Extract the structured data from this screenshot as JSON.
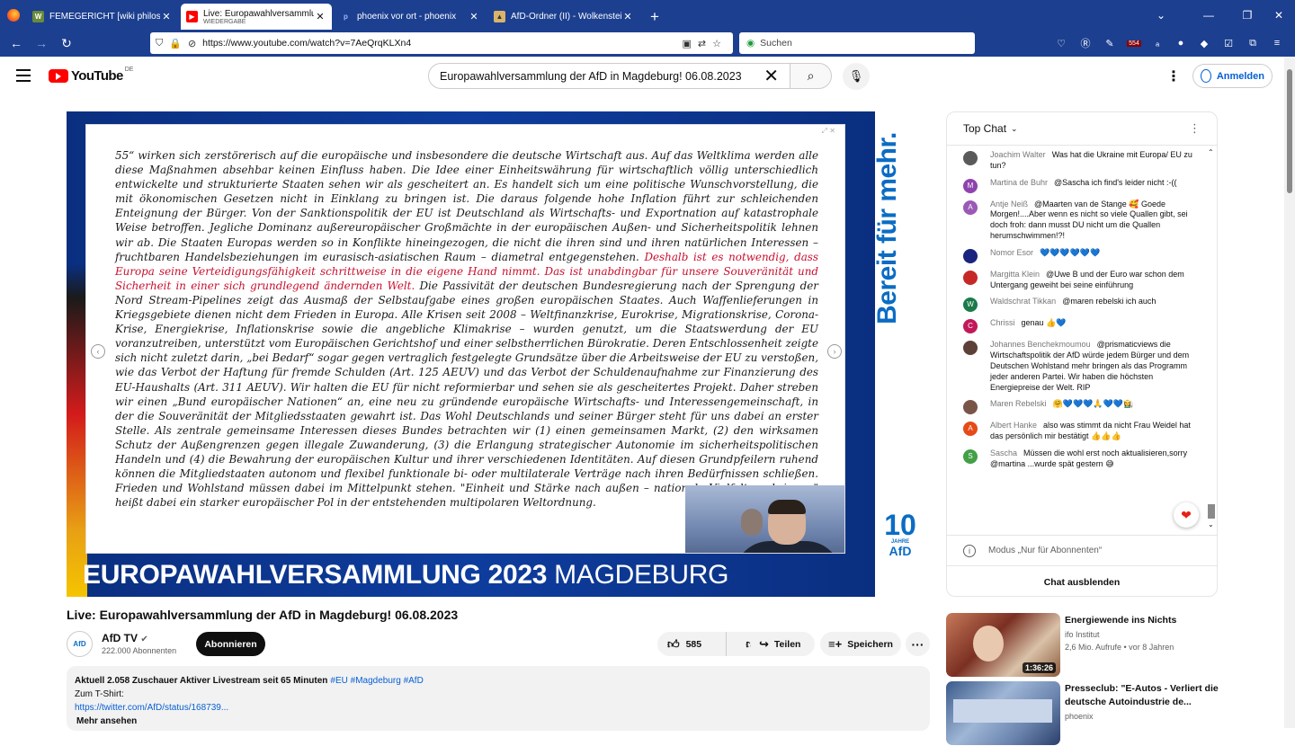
{
  "browser": {
    "tabs": [
      {
        "title": "FEMEGERICHT [wiki philosoph",
        "subtitle": "",
        "active": false
      },
      {
        "title": "Live: Europawahlversammlung",
        "subtitle": "WIEDERGABE",
        "active": true
      },
      {
        "title": "phoenix vor ort - phoenix",
        "subtitle": "",
        "active": false
      },
      {
        "title": "AfD-Ordner (II) - Wolkenstein-F",
        "subtitle": "",
        "active": false
      }
    ],
    "url": "https://www.youtube.com/watch?v=7AeQrqKLXn4",
    "search_placeholder": "Suchen",
    "ext_badge": "554"
  },
  "youtube": {
    "logo": "YouTube",
    "country": "DE",
    "search_value": "Europawahlversammlung der AfD in Magdeburg! 06.08.2023",
    "signin": "Anmelden"
  },
  "player": {
    "doc_text_1": "55“ wirken sich zerstörerisch auf die europäische und insbesondere die deutsche Wirtschaft aus. Auf das Weltklima werden alle diese Maßnahmen absehbar keinen Einfluss haben. Die Idee einer Einheitswährung für wirtschaftlich völlig unterschiedlich entwickelte und strukturierte Staaten sehen wir als gescheitert an. Es handelt sich um eine politische Wunschvorstellung, die mit ökonomischen Gesetzen nicht in Einklang zu bringen ist. Die daraus folgende hohe Inflation führt zur schleichenden Enteignung der Bürger. Von der Sanktionspolitik der EU ist Deutschland als Wirtschafts- und Exportnation auf katastrophale Weise betroffen. Jegliche Dominanz außereuropäischer Großmächte in der europäischen Außen- und Sicherheitspolitik lehnen wir ab. Die Staaten Europas werden so in Konflikte hineingezogen, die nicht die ihren sind und ihren natürlichen Interessen – fruchtbaren Handelsbeziehungen im eurasisch-asiatischen Raum – diametral entgegenstehen.",
    "doc_text_red": "Deshalb ist es notwendig, dass Europa seine Verteidigungsfähigkeit schrittweise in die eigene Hand nimmt. Das ist unabdingbar für unsere Souveränität und Sicherheit in einer sich grundlegend ändernden Welt.",
    "doc_text_2": "Die Passivität der deutschen Bundesregierung nach der Sprengung der Nord Stream-Pipelines zeigt das Ausmaß der Selbstaufgabe eines großen europäischen Staates. Auch Waffenlieferungen in Kriegsgebiete dienen nicht dem Frieden in Europa. Alle Krisen seit 2008 – Weltfinanzkrise, Eurokrise, Migrationskrise, Corona-Krise, Energiekrise, Inflationskrise sowie die angebliche Klimakrise – wurden genutzt, um die Staatswerdung der EU voranzutreiben, unterstützt vom Europäischen Gerichtshof und einer selbstherrlichen Bürokratie. Deren Entschlossenheit zeigte sich nicht zuletzt darin, „bei Bedarf“ sogar gegen vertraglich festgelegte Grundsätze über die Arbeitsweise der EU zu verstoßen, wie das Verbot der Haftung für fremde Schulden (Art. 125 AEUV) und das Verbot der Schuldenaufnahme zur Finanzierung des EU-Haushalts (Art. 311 AEUV). Wir halten die EU für nicht reformierbar und sehen sie als gescheitertes Projekt. Daher streben wir einen „Bund europäischer Nationen“ an, eine neu zu gründende europäische Wirtschafts- und Interessengemeinschaft, in der die Souveränität der Mitgliedsstaaten gewahrt ist. Das Wohl Deutschlands und seiner Bürger steht für uns dabei an erster Stelle. Als zentrale gemeinsame Interessen dieses Bundes betrachten wir (1) einen gemeinsamen Markt, (2) den wirksamen Schutz der Außengrenzen gegen illegale Zuwanderung, (3) die Erlangung strategischer Autonomie im sicherheitspolitischen Handeln und (4) die Bewahrung der europäischen Kultur und ihrer verschiedenen Identitäten. Auf diesen Grundpfeilern ruhend können die Mitgliedstaaten autonom und flexibel funktionale bi- oder multilaterale Verträge nach ihren Bedürfnissen schließen. Frieden und Wohlstand müssen dabei im Mittelpunkt stehen. \"Einheit und Stärke nach außen – nationale Vielfalt nach innen\" heißt dabei ein starker europäischer Pol in der entstehenden multipolaren Weltordnung.",
    "banner_bold": "EUROPAWAHLVERSAMMLUNG 2023",
    "banner_thin": "MAGDEBURG",
    "slogan": "Bereit für mehr.",
    "afd_number": "10",
    "afd_jahre": "JAHRE",
    "afd_name": "AfD"
  },
  "chat": {
    "header": "Top Chat",
    "messages": [
      {
        "author": "Joachim Walter",
        "text": "Was hat die Ukraine mit Europa/ EU zu tun?",
        "avatar_color": "#5a5a5a",
        "initial": ""
      },
      {
        "author": "Martina de Buhr",
        "text": "@Sascha ich find's leider nicht :-((",
        "avatar_color": "#8e44ad",
        "initial": "M"
      },
      {
        "author": "Antje Neiß",
        "text": "@Maarten van de Stange 🥰 Goede Morgen!....Aber wenn es nicht so viele Quallen gibt, sei doch froh: dann musst DU nicht um die Quallen herumschwimmen!?!",
        "avatar_color": "#9b59b6",
        "initial": "A"
      },
      {
        "author": "Nomor Esor",
        "text": "💙💙💙💙💙💙",
        "avatar_color": "#1a237e",
        "initial": ""
      },
      {
        "author": "Margitta Klein",
        "text": "@Uwe B und der Euro war schon dem Untergang geweiht bei seine einführung",
        "avatar_color": "#c62828",
        "initial": ""
      },
      {
        "author": "Waldschrat Tikkan",
        "text": "@maren rebelski ich auch",
        "avatar_color": "#1b7a4a",
        "initial": "W"
      },
      {
        "author": "Chrissi",
        "text": "genau 👍💙",
        "avatar_color": "#c2185b",
        "initial": "C"
      },
      {
        "author": "Johannes Benchekmoumou",
        "text": "@prismaticviews die Wirtschaftspolitik der AfD würde jedem Bürger und dem Deutschen Wohlstand mehr bringen als das Programm jeder anderen Partei. Wir haben die höchsten Energiepreise der Welt. RIP",
        "avatar_color": "#5d4037",
        "initial": ""
      },
      {
        "author": "Maren Rebelski",
        "text": "🤗💙💙💙🙏💙💙👩‍🌾",
        "avatar_color": "#795548",
        "initial": ""
      },
      {
        "author": "Albert Hanke",
        "text": "also was stimmt da nicht Frau Weidel hat das persönlich mir bestätigt 👍👍👍",
        "avatar_color": "#e64a19",
        "initial": "A"
      },
      {
        "author": "Sascha",
        "text": "Müssen die wohl erst noch aktualisieren,sorry @martina ...wurde spät gestern 😅",
        "avatar_color": "#43a047",
        "initial": "S"
      }
    ],
    "mode": "Modus „Nur für Abonnenten“",
    "hide": "Chat ausblenden"
  },
  "video": {
    "title": "Live: Europawahlversammlung der AfD in Magdeburg! 06.08.2023",
    "channel": "AfD TV",
    "channel_avatar": "AfD",
    "subscribers": "222.000 Abonnenten",
    "subscribe": "Abonnieren",
    "likes": "585",
    "share": "Teilen",
    "save": "Speichern",
    "desc_stats": "Aktuell 2.058 Zuschauer  Aktiver Livestream seit 65 Minuten",
    "desc_tags": "#EU #Magdeburg #AfD",
    "desc_line2": "Zum T-Shirt:",
    "desc_link": "https://twitter.com/AfD/status/168739...",
    "desc_more": "Mehr ansehen"
  },
  "recommendations": [
    {
      "title": "Energiewende ins Nichts",
      "channel": "ifo Institut",
      "meta": "2,6 Mio. Aufrufe • vor 8 Jahren",
      "duration": "1:36:26"
    },
    {
      "title": "Presseclub: \"E-Autos - Verliert die deutsche Autoindustrie de...",
      "channel": "phoenix",
      "meta": "",
      "duration": ""
    }
  ]
}
